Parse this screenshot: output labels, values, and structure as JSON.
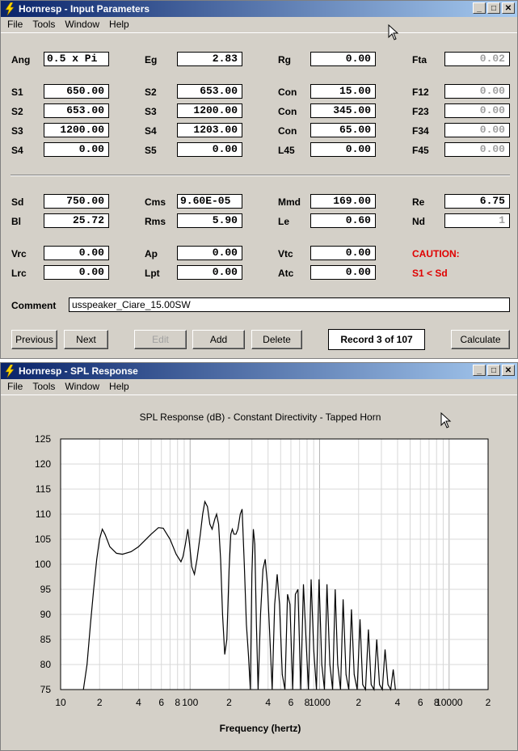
{
  "window1": {
    "title": "Hornresp - Input Parameters"
  },
  "window2": {
    "title": "Hornresp - SPL Response"
  },
  "menu": [
    "File",
    "Tools",
    "Window",
    "Help"
  ],
  "params": {
    "ang": {
      "label": "Ang",
      "value": "0.5 x Pi"
    },
    "eg": {
      "label": "Eg",
      "value": "2.83"
    },
    "rg": {
      "label": "Rg",
      "value": "0.00"
    },
    "fta": {
      "label": "Fta",
      "value": "0.02"
    },
    "s1a": {
      "label": "S1",
      "value": "650.00"
    },
    "s2a": {
      "label": "S2",
      "value": "653.00"
    },
    "con1": {
      "label": "Con",
      "value": "15.00"
    },
    "f12": {
      "label": "F12",
      "value": "0.00"
    },
    "s2b": {
      "label": "S2",
      "value": "653.00"
    },
    "s3a": {
      "label": "S3",
      "value": "1200.00"
    },
    "con2": {
      "label": "Con",
      "value": "345.00"
    },
    "f23": {
      "label": "F23",
      "value": "0.00"
    },
    "s3b": {
      "label": "S3",
      "value": "1200.00"
    },
    "s4a": {
      "label": "S4",
      "value": "1203.00"
    },
    "con3": {
      "label": "Con",
      "value": "65.00"
    },
    "f34": {
      "label": "F34",
      "value": "0.00"
    },
    "s4b": {
      "label": "S4",
      "value": "0.00"
    },
    "s5": {
      "label": "S5",
      "value": "0.00"
    },
    "l45": {
      "label": "L45",
      "value": "0.00"
    },
    "f45": {
      "label": "F45",
      "value": "0.00"
    },
    "sd": {
      "label": "Sd",
      "value": "750.00"
    },
    "cms": {
      "label": "Cms",
      "value": "9.60E-05"
    },
    "mmd": {
      "label": "Mmd",
      "value": "169.00"
    },
    "re": {
      "label": "Re",
      "value": "6.75"
    },
    "bl": {
      "label": "Bl",
      "value": "25.72"
    },
    "rms": {
      "label": "Rms",
      "value": "5.90"
    },
    "le": {
      "label": "Le",
      "value": "0.60"
    },
    "nd": {
      "label": "Nd",
      "value": "1"
    },
    "vrc": {
      "label": "Vrc",
      "value": "0.00"
    },
    "ap": {
      "label": "Ap",
      "value": "0.00"
    },
    "vtc": {
      "label": "Vtc",
      "value": "0.00"
    },
    "lrc": {
      "label": "Lrc",
      "value": "0.00"
    },
    "lpt": {
      "label": "Lpt",
      "value": "0.00"
    },
    "atc": {
      "label": "Atc",
      "value": "0.00"
    }
  },
  "caution": {
    "line1": "CAUTION:",
    "line2": "S1 < Sd"
  },
  "comment": {
    "label": "Comment",
    "value": "usspeaker_Ciare_15.00SW"
  },
  "buttons": {
    "previous": "Previous",
    "next": "Next",
    "edit": "Edit",
    "add": "Add",
    "delete": "Delete",
    "calculate": "Calculate"
  },
  "record": "Record 3 of 107",
  "colors": {
    "title_start": "#0a246a",
    "title_end": "#a6caf0",
    "caution": "#e00000"
  },
  "chart_data": {
    "type": "line",
    "title": "SPL Response (dB) - Constant Directivity - Tapped Horn",
    "xlabel": "Frequency (hertz)",
    "ylabel": "",
    "x_scale": "log",
    "xlim": [
      10,
      20000
    ],
    "ylim": [
      75,
      125
    ],
    "yticks": [
      75,
      80,
      85,
      90,
      95,
      100,
      105,
      110,
      115,
      120,
      125
    ],
    "xtick_labels": [
      {
        "v": 10,
        "t": "10"
      },
      {
        "v": 20,
        "t": "2"
      },
      {
        "v": 40,
        "t": "4"
      },
      {
        "v": 60,
        "t": "6"
      },
      {
        "v": 80,
        "t": "8"
      },
      {
        "v": 100,
        "t": "100"
      },
      {
        "v": 200,
        "t": "2"
      },
      {
        "v": 400,
        "t": "4"
      },
      {
        "v": 600,
        "t": "6"
      },
      {
        "v": 800,
        "t": "8"
      },
      {
        "v": 1000,
        "t": "1000"
      },
      {
        "v": 2000,
        "t": "2"
      },
      {
        "v": 4000,
        "t": "4"
      },
      {
        "v": 6000,
        "t": "6"
      },
      {
        "v": 8000,
        "t": "8"
      },
      {
        "v": 10000,
        "t": "10000"
      },
      {
        "v": 20000,
        "t": "2"
      }
    ],
    "grid": true,
    "series": [
      {
        "values": [
          [
            15,
            75
          ],
          [
            16,
            80
          ],
          [
            17,
            88
          ],
          [
            18,
            95
          ],
          [
            19,
            101
          ],
          [
            20,
            105
          ],
          [
            21,
            107
          ],
          [
            22,
            106
          ],
          [
            24,
            103.5
          ],
          [
            27,
            102.2
          ],
          [
            30,
            102
          ],
          [
            35,
            102.5
          ],
          [
            40,
            103.5
          ],
          [
            50,
            106
          ],
          [
            57,
            107.3
          ],
          [
            62,
            107.2
          ],
          [
            70,
            105
          ],
          [
            78,
            102
          ],
          [
            85,
            100.5
          ],
          [
            88,
            101.5
          ],
          [
            92,
            104
          ],
          [
            96,
            107
          ],
          [
            99,
            104
          ],
          [
            103,
            99.5
          ],
          [
            108,
            98
          ],
          [
            113,
            101
          ],
          [
            120,
            106
          ],
          [
            125,
            110
          ],
          [
            130,
            112.5
          ],
          [
            136,
            111.5
          ],
          [
            142,
            108
          ],
          [
            148,
            107
          ],
          [
            155,
            109
          ],
          [
            160,
            110
          ],
          [
            166,
            108
          ],
          [
            172,
            101
          ],
          [
            178,
            90
          ],
          [
            185,
            82
          ],
          [
            192,
            85
          ],
          [
            200,
            99
          ],
          [
            206,
            106
          ],
          [
            212,
            107
          ],
          [
            218,
            106
          ],
          [
            226,
            106
          ],
          [
            234,
            107
          ],
          [
            244,
            110
          ],
          [
            252,
            111
          ],
          [
            262,
            100
          ],
          [
            272,
            88
          ],
          [
            282,
            82
          ],
          [
            292,
            75
          ],
          [
            300,
            98
          ],
          [
            308,
            107
          ],
          [
            316,
            104
          ],
          [
            325,
            88
          ],
          [
            335,
            75
          ],
          [
            350,
            90
          ],
          [
            365,
            99
          ],
          [
            380,
            101
          ],
          [
            395,
            96
          ],
          [
            410,
            87
          ],
          [
            430,
            75
          ],
          [
            450,
            92
          ],
          [
            470,
            98
          ],
          [
            490,
            92
          ],
          [
            515,
            78
          ],
          [
            540,
            75
          ],
          [
            565,
            94
          ],
          [
            590,
            92
          ],
          [
            620,
            75
          ],
          [
            650,
            94
          ],
          [
            680,
            95
          ],
          [
            715,
            75
          ],
          [
            750,
            96
          ],
          [
            785,
            85
          ],
          [
            820,
            75
          ],
          [
            860,
            97
          ],
          [
            900,
            83
          ],
          [
            945,
            75
          ],
          [
            990,
            97
          ],
          [
            1040,
            80
          ],
          [
            1090,
            75
          ],
          [
            1140,
            96
          ],
          [
            1200,
            80
          ],
          [
            1260,
            75
          ],
          [
            1320,
            95
          ],
          [
            1380,
            80
          ],
          [
            1450,
            75
          ],
          [
            1520,
            93
          ],
          [
            1600,
            78
          ],
          [
            1680,
            75
          ],
          [
            1760,
            91
          ],
          [
            1850,
            78
          ],
          [
            1950,
            75
          ],
          [
            2050,
            89
          ],
          [
            2150,
            76
          ],
          [
            2260,
            75
          ],
          [
            2380,
            87
          ],
          [
            2500,
            76
          ],
          [
            2630,
            75
          ],
          [
            2760,
            85
          ],
          [
            2900,
            76
          ],
          [
            3050,
            75
          ],
          [
            3200,
            83
          ],
          [
            3370,
            76
          ],
          [
            3540,
            75
          ],
          [
            3700,
            79
          ],
          [
            3850,
            75
          ]
        ]
      }
    ]
  }
}
